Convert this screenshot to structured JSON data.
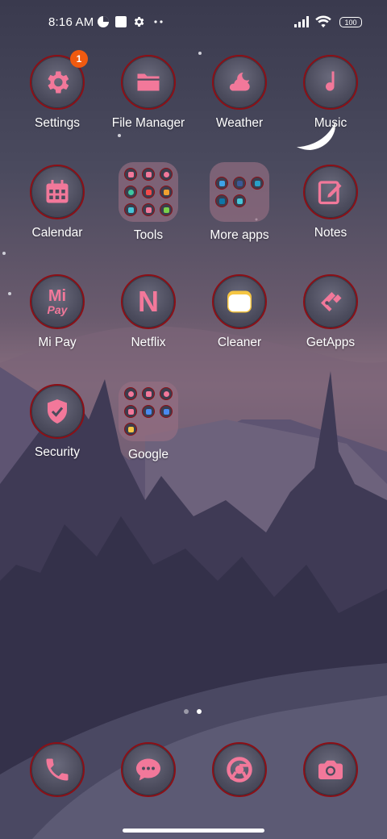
{
  "status_bar": {
    "time": "8:16 AM",
    "battery": "100",
    "left_icons": [
      "data-saver-icon",
      "app-notification-icon",
      "gear-icon",
      "more-dots-icon"
    ],
    "right_icons": [
      "signal-icon",
      "wifi-icon",
      "battery-icon"
    ]
  },
  "apps": [
    {
      "label": "Settings",
      "icon": "gear-icon",
      "badge": "1"
    },
    {
      "label": "File Manager",
      "icon": "folder-icon"
    },
    {
      "label": "Weather",
      "icon": "cloud-moon-icon"
    },
    {
      "label": "Music",
      "icon": "music-note-icon"
    },
    {
      "label": "Calendar",
      "icon": "calendar-icon"
    },
    {
      "label": "Tools",
      "icon": "folder-tools"
    },
    {
      "label": "More apps",
      "icon": "folder-more-apps"
    },
    {
      "label": "Notes",
      "icon": "notes-icon"
    },
    {
      "label": "Mi Pay",
      "icon": "mi-pay-icon",
      "icon_text_top": "Mi",
      "icon_text_bottom": "Pay"
    },
    {
      "label": "Netflix",
      "icon": "netflix-icon",
      "icon_text": "N"
    },
    {
      "label": "Cleaner",
      "icon": "cleaner-icon"
    },
    {
      "label": "GetApps",
      "icon": "getapps-icon"
    },
    {
      "label": "Security",
      "icon": "shield-icon"
    },
    {
      "label": "Google",
      "icon": "folder-google"
    }
  ],
  "dock": [
    {
      "name": "phone",
      "icon": "phone-icon"
    },
    {
      "name": "messaging",
      "icon": "message-icon"
    },
    {
      "name": "chrome",
      "icon": "chrome-icon"
    },
    {
      "name": "camera",
      "icon": "camera-icon"
    }
  ],
  "page_indicator": {
    "pages": 2,
    "active": 2
  },
  "colors": {
    "icon_accent": "#f2789a",
    "icon_ring": "#8b0f16",
    "badge": "#f05a0f"
  }
}
